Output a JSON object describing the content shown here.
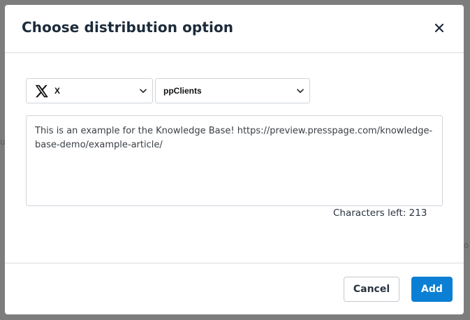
{
  "dialog": {
    "title": "Choose distribution option",
    "close_icon": "close-icon"
  },
  "platform_select": {
    "value": "X",
    "icon": "x-logo-icon"
  },
  "account_select": {
    "value": "ppClients"
  },
  "message": {
    "value": "This is an example for the Knowledge Base! https://preview.presspage.com/knowledge-base-demo/example-article/"
  },
  "characters_left": "Characters left: 213",
  "footer": {
    "cancel_label": "Cancel",
    "add_label": "Add"
  },
  "colors": {
    "accent": "#0a7fd4",
    "title": "#1c2b3a",
    "backdrop": "#7d7d7d"
  }
}
